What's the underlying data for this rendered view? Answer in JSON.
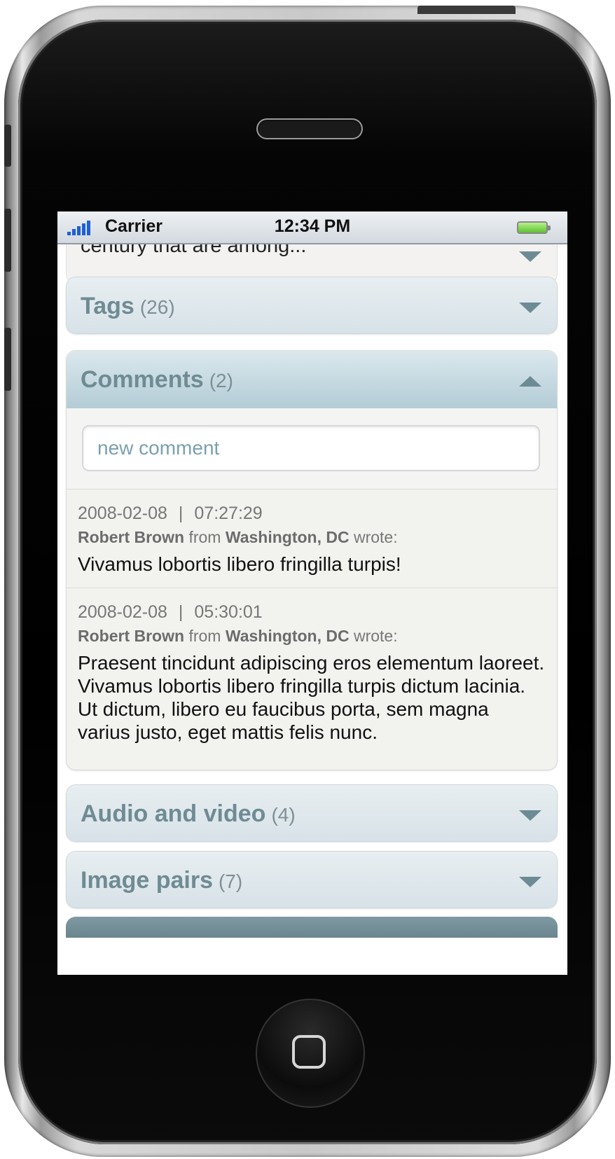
{
  "status_bar": {
    "carrier": "Carrier",
    "time": "12:34 PM"
  },
  "description": {
    "text": "century that are among..."
  },
  "sections": {
    "tags": {
      "label": "Tags",
      "count": "(26)"
    },
    "comments": {
      "label": "Comments",
      "count": "(2)"
    },
    "audio_video": {
      "label": "Audio and video",
      "count": "(4)"
    },
    "image_pairs": {
      "label": "Image pairs",
      "count": "(7)"
    }
  },
  "comment_form": {
    "placeholder": "new comment"
  },
  "comments": [
    {
      "date": "2008-02-08",
      "separator": "|",
      "time": "07:27:29",
      "author": "Robert Brown",
      "from_word": "from",
      "location": "Washington, DC",
      "wrote_word": "wrote:",
      "body": "Vivamus lobortis libero fringilla turpis!"
    },
    {
      "date": "2008-02-08",
      "separator": "|",
      "time": "05:30:01",
      "author": "Robert Brown",
      "from_word": "from",
      "location": "Washington, DC",
      "wrote_word": "wrote:",
      "body": "Praesent tincidunt adipiscing eros elementum laoreet. Vivamus lobortis libero fringilla turpis dictum lacinia. Ut dictum, libero eu faucibus porta, sem magna varius justo, eget mattis felis nunc."
    }
  ],
  "colors": {
    "header_text": "#6f8b93",
    "active_header": "#b3ccd6",
    "signal_blue": "#1f5fd8",
    "battery_green": "#5ec22f"
  },
  "icons": {
    "collapsed": "triangle-down-icon",
    "expanded": "triangle-up-icon"
  }
}
